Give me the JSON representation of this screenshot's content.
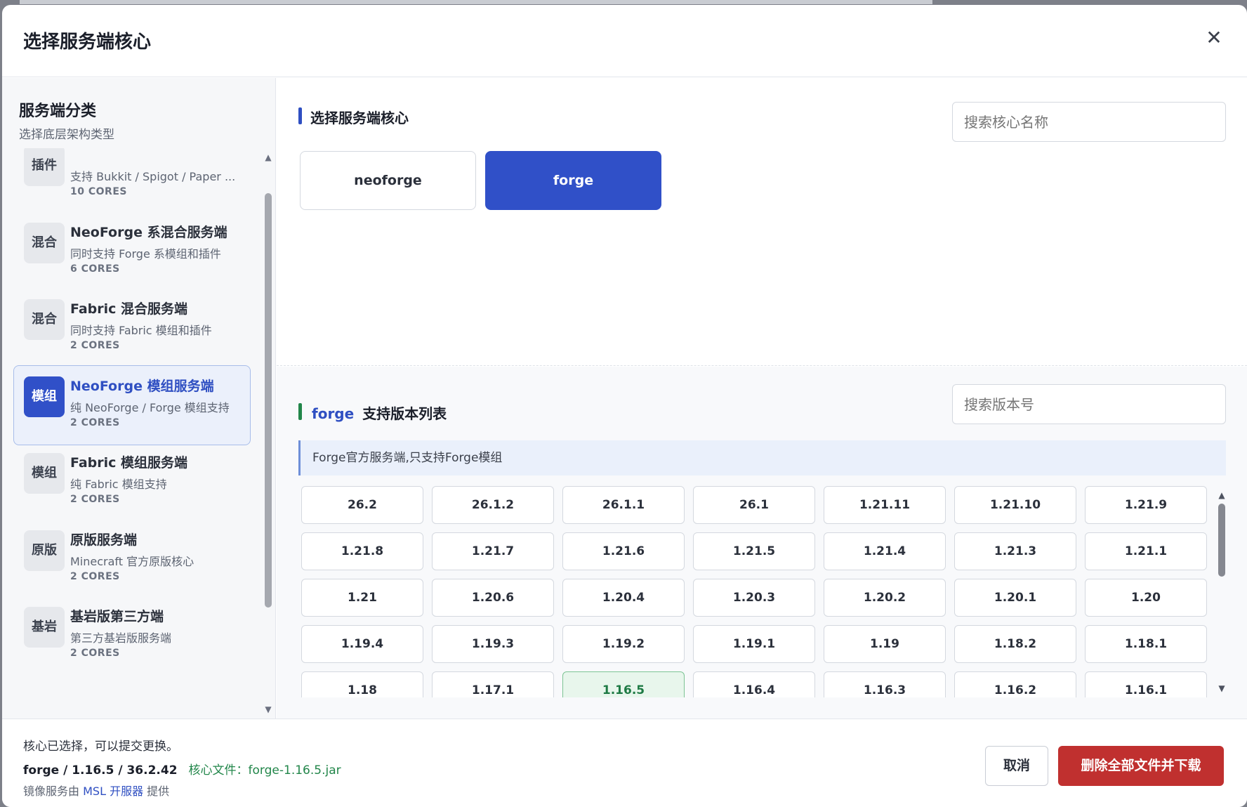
{
  "dialog": {
    "title": "选择服务端核心",
    "close_glyph": "✕"
  },
  "sidebar": {
    "title": "服务端分类",
    "subtitle": "选择底层架构类型",
    "categories": [
      {
        "badge": "插件",
        "name": "",
        "desc": "支持 Bukkit / Spigot / Paper ...",
        "cores": "10 CORES"
      },
      {
        "badge": "混合",
        "name": "NeoForge 系混合服务端",
        "desc": "同时支持 Forge 系模组和插件",
        "cores": "6 CORES"
      },
      {
        "badge": "混合",
        "name": "Fabric 混合服务端",
        "desc": "同时支持 Fabric 模组和插件",
        "cores": "2 CORES"
      },
      {
        "badge": "模组",
        "name": "NeoForge 模组服务端",
        "desc": "纯 NeoForge / Forge 模组支持",
        "cores": "2 CORES"
      },
      {
        "badge": "模组",
        "name": "Fabric 模组服务端",
        "desc": "纯 Fabric 模组支持",
        "cores": "2 CORES"
      },
      {
        "badge": "原版",
        "name": "原版服务端",
        "desc": "Minecraft 官方原版核心",
        "cores": "2 CORES"
      },
      {
        "badge": "基岩",
        "name": "基岩版第三方端",
        "desc": "第三方基岩版服务端",
        "cores": "2 CORES"
      }
    ],
    "active_index": 3
  },
  "cores_section": {
    "heading": "选择服务端核心",
    "search_placeholder": "搜索核心名称",
    "cores": [
      "neoforge",
      "forge"
    ],
    "selected": "forge"
  },
  "versions_section": {
    "core_name": "forge",
    "heading": "支持版本列表",
    "search_placeholder": "搜索版本号",
    "note": "Forge官方服务端,只支持Forge模组",
    "versions": [
      "26.2",
      "26.1.2",
      "26.1.1",
      "26.1",
      "1.21.11",
      "1.21.10",
      "1.21.9",
      "1.21.8",
      "1.21.7",
      "1.21.6",
      "1.21.5",
      "1.21.4",
      "1.21.3",
      "1.21.1",
      "1.21",
      "1.20.6",
      "1.20.4",
      "1.20.3",
      "1.20.2",
      "1.20.1",
      "1.20",
      "1.19.4",
      "1.19.3",
      "1.19.2",
      "1.19.1",
      "1.19",
      "1.18.2",
      "1.18.1",
      "1.18",
      "1.17.1",
      "1.16.5",
      "1.16.4",
      "1.16.3",
      "1.16.2",
      "1.16.1"
    ],
    "selected": "1.16.5"
  },
  "footer": {
    "status": "核心已选择，可以提交更换。",
    "selection": "forge / 1.16.5 / 36.2.42",
    "file_label": "核心文件：",
    "file_name": "forge-1.16.5.jar",
    "mirror_prefix": "镜像服务由",
    "mirror_link": "MSL 开服器",
    "mirror_suffix": "提供",
    "cancel_label": "取消",
    "confirm_label": "删除全部文件并下载"
  },
  "colors": {
    "accent": "#3050c8",
    "danger": "#c0302f",
    "success": "#22864a"
  }
}
